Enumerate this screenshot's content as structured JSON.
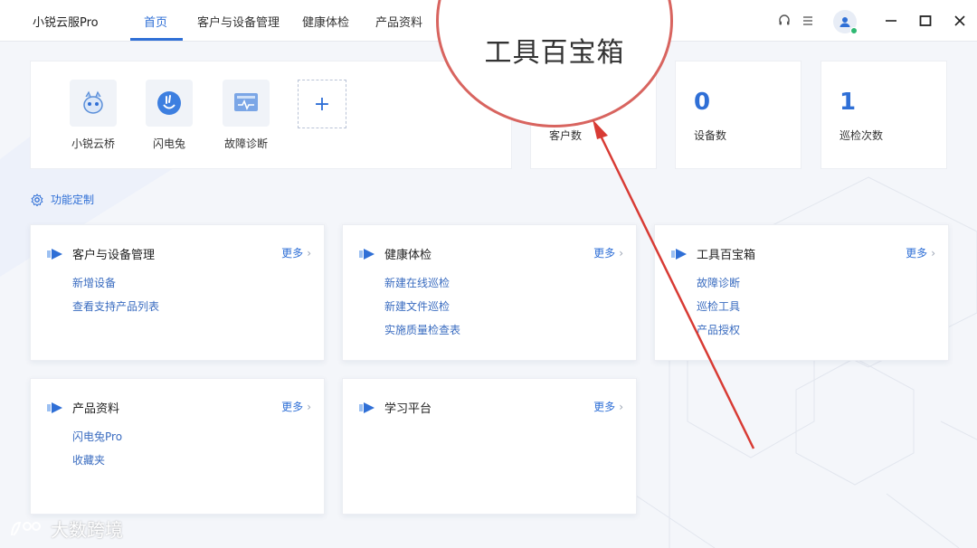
{
  "app": {
    "title": "小锐云服Pro"
  },
  "nav": {
    "tabs": [
      {
        "label": "首页"
      },
      {
        "label": "客户与设备管理"
      },
      {
        "label": "健康体检"
      },
      {
        "label": "产品资料"
      }
    ]
  },
  "quick": {
    "items": [
      {
        "label": "小锐云桥",
        "icon": "bridge-mascot-icon"
      },
      {
        "label": "闪电兔",
        "icon": "lightning-rabbit-icon"
      },
      {
        "label": "故障诊断",
        "icon": "diagnosis-icon"
      }
    ],
    "add_label": "+"
  },
  "stats": {
    "customers": {
      "label": "客户数"
    },
    "devices": {
      "value": "0",
      "label": "设备数"
    },
    "inspections": {
      "value": "1",
      "label": "巡检次数"
    }
  },
  "customize": {
    "label": "功能定制"
  },
  "cards": {
    "more_label": "更多",
    "customer": {
      "title": "客户与设备管理",
      "links": [
        "新增设备",
        "查看支持产品列表"
      ]
    },
    "health": {
      "title": "健康体检",
      "links": [
        "新建在线巡检",
        "新建文件巡检",
        "实施质量检查表"
      ]
    },
    "toolbox": {
      "title": "工具百宝箱",
      "links": [
        "故障诊断",
        "巡检工具",
        "产品授权"
      ]
    },
    "product": {
      "title": "产品资料",
      "links": [
        "闪电兔Pro",
        "收藏夹"
      ]
    },
    "learning": {
      "title": "学习平台"
    }
  },
  "annotation": {
    "magnified_text": "工具百宝箱"
  },
  "watermark": {
    "text": "大数跨境"
  },
  "colors": {
    "accent": "#2f6fd6",
    "annotation": "#d8645f",
    "status_online": "#2eb872"
  }
}
